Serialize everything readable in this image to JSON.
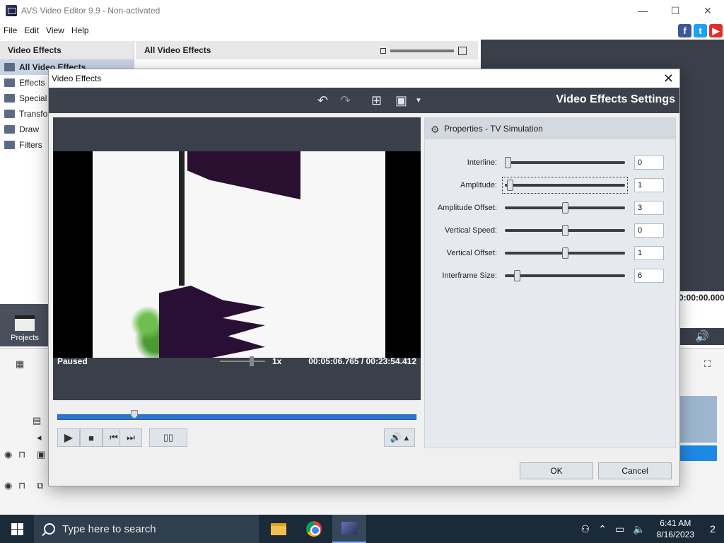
{
  "app": {
    "title": "AVS Video Editor 9.9 - Non-activated",
    "minimize": "—",
    "maximize": "☐",
    "close": "✕"
  },
  "menu": [
    "File",
    "Edit",
    "View",
    "Help"
  ],
  "social": [
    "f",
    "t",
    "▶"
  ],
  "left_panel": {
    "title": "Video Effects",
    "items": [
      "All Video Effects",
      "Effects",
      "Special",
      "Transform",
      "Draw",
      "Filters"
    ]
  },
  "mid_panel": {
    "title": "All Video Effects"
  },
  "right_area": {
    "time": "0:00:00.000"
  },
  "projects": {
    "label": "Projects"
  },
  "dialog": {
    "title": "Video Effects",
    "close": "✕",
    "toolbar_title": "Video Effects Settings",
    "status": "Paused",
    "speed": "1x",
    "time": "00:05:06.765  /  00:23:54.412",
    "playback_progress": 0.214,
    "properties_title": "Properties - TV Simulation",
    "properties": [
      {
        "label": "Interline:",
        "value": "0",
        "level": 0.0
      },
      {
        "label": "Amplitude:",
        "value": "1",
        "level": 0.02
      },
      {
        "label": "Amplitude Offset:",
        "value": "3",
        "level": 0.5
      },
      {
        "label": "Vertical Speed:",
        "value": "0",
        "level": 0.5
      },
      {
        "label": "Vertical Offset:",
        "value": "1",
        "level": 0.5
      },
      {
        "label": "Interframe Size:",
        "value": "6",
        "level": 0.08
      }
    ],
    "ok": "OK",
    "cancel": "Cancel"
  },
  "taskbar": {
    "search_placeholder": "Type here to search",
    "time": "6:41 AM",
    "date": "8/16/2023",
    "notifications": "2"
  }
}
